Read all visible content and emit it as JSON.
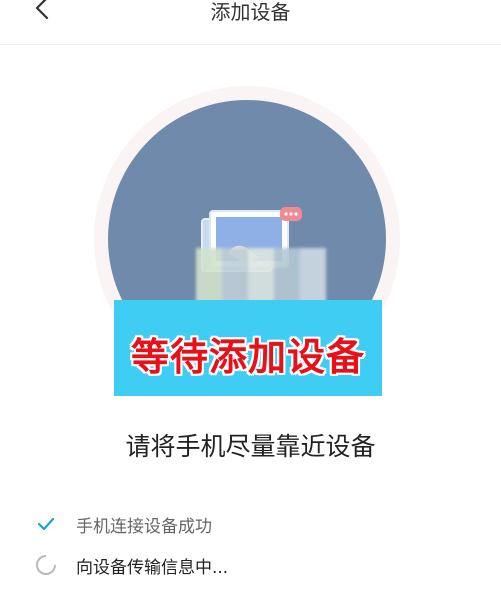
{
  "header": {
    "title": "添加设备",
    "back_icon": "chevron-left-icon"
  },
  "illustration": {
    "circle_color": "#6f8aaa",
    "icon": "laptop-icon"
  },
  "banner": {
    "text": "等待添加设备",
    "background": "#3fcdf4",
    "text_color": "#e8111a"
  },
  "instruction": "请将手机尽量靠近设备",
  "steps": [
    {
      "label": "手机连接设备成功",
      "status": "done",
      "icon": "check-icon"
    },
    {
      "label": "向设备传输信息中...",
      "status": "in-progress",
      "icon": "loading-spinner-icon"
    }
  ]
}
